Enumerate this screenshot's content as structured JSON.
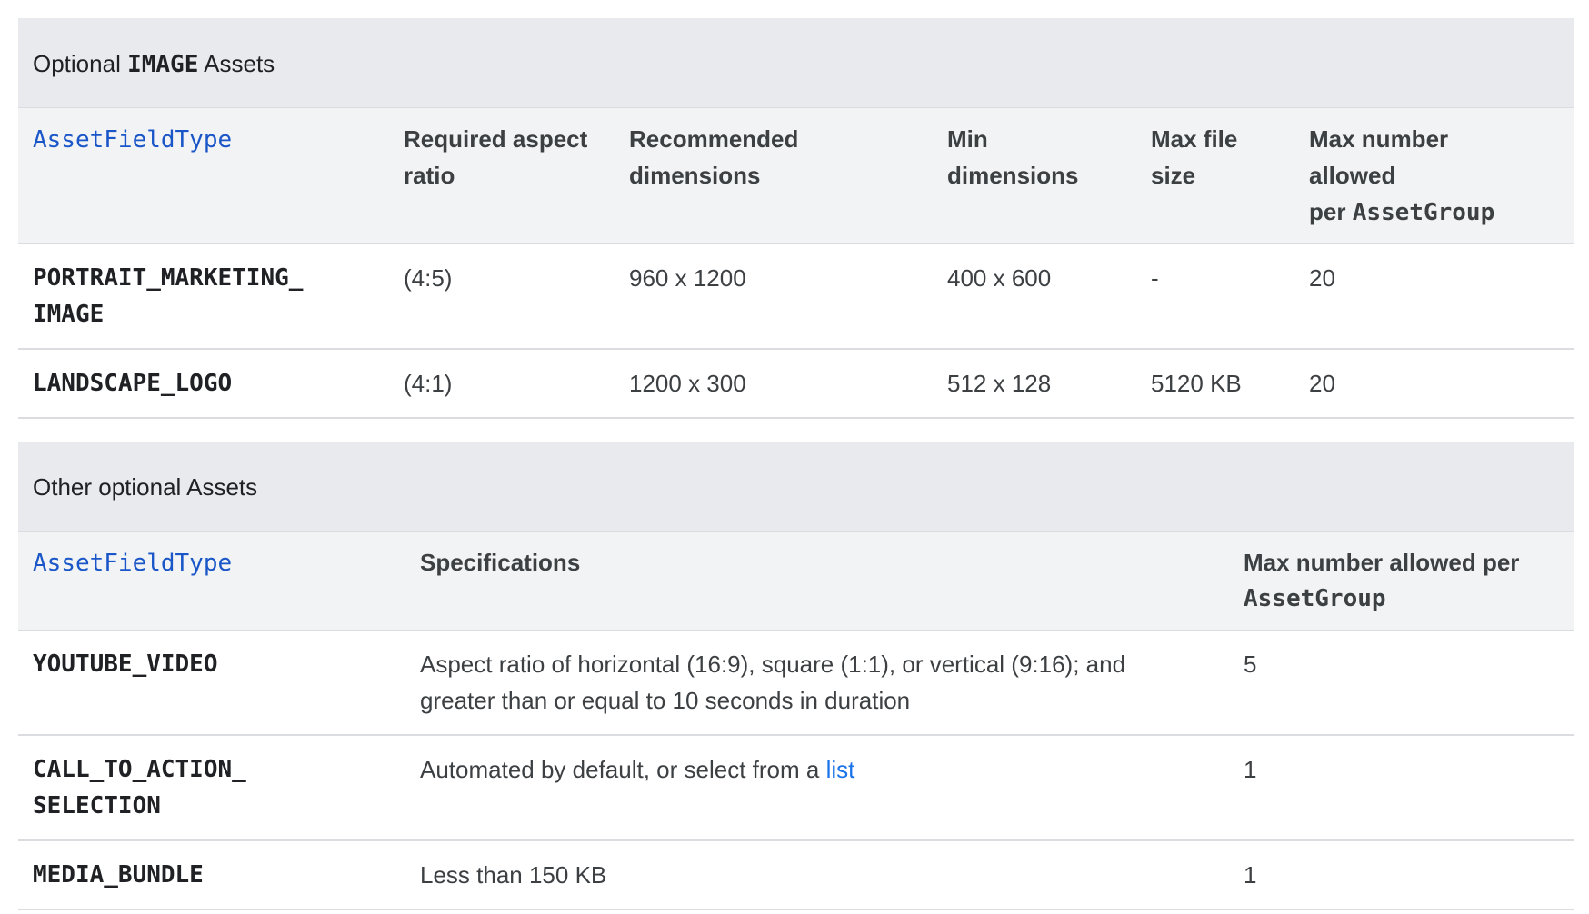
{
  "image_table": {
    "title_prefix": "Optional ",
    "title_code": "IMAGE",
    "title_suffix": " Assets",
    "headers": {
      "field_type": "AssetFieldType",
      "aspect_ratio_line1": "Required aspect",
      "aspect_ratio_line2": "ratio",
      "recommended_line1": "Recommended",
      "recommended_line2": "dimensions",
      "min_line1": "Min",
      "min_line2": "dimensions",
      "max_file_line1": "Max file",
      "max_file_line2": "size",
      "max_number_line1": "Max number",
      "max_number_line2": "allowed",
      "max_number_line3_prefix": "per ",
      "max_number_line3_code": "AssetGroup"
    },
    "rows": [
      {
        "type_line1": "PORTRAIT_MARKETING_",
        "type_line2": "IMAGE",
        "aspect_ratio": "(4:5)",
        "recommended": "960 x 1200",
        "min": "400 x 600",
        "max_file": "-",
        "max_number": "20"
      },
      {
        "type_line1": "LANDSCAPE_LOGO",
        "type_line2": "",
        "aspect_ratio": "(4:1)",
        "recommended": "1200 x 300",
        "min": "512 x 128",
        "max_file": "5120 KB",
        "max_number": "20"
      }
    ]
  },
  "other_table": {
    "title": "Other optional Assets",
    "headers": {
      "field_type": "AssetFieldType",
      "specifications": "Specifications",
      "max_number_line1": "Max number allowed per",
      "max_number_line2_code": "AssetGroup"
    },
    "rows": [
      {
        "type_line1": "YOUTUBE_VIDEO",
        "type_line2": "",
        "spec_text": "Aspect ratio of horizontal (16:9), square (1:1), or vertical (9:16); and greater than or equal to 10 seconds in duration",
        "spec_link": "",
        "max_number": "5"
      },
      {
        "type_line1": "CALL_TO_ACTION_",
        "type_line2": "SELECTION",
        "spec_text": "Automated by default, or select from a ",
        "spec_link": "list",
        "max_number": "1"
      },
      {
        "type_line1": "MEDIA_BUNDLE",
        "type_line2": "",
        "spec_text": "Less than 150 KB",
        "spec_link": "",
        "max_number": "1"
      }
    ]
  }
}
